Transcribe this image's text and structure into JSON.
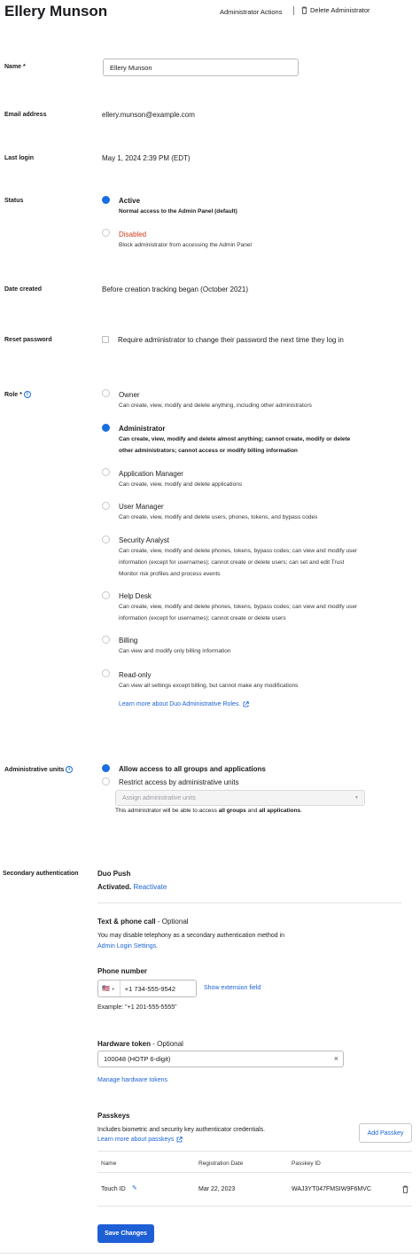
{
  "header": {
    "title": "Ellery Munson",
    "admin_actions": "Administrator Actions",
    "delete_admin": "Delete Administrator"
  },
  "name": {
    "label": "Name *",
    "value": "Ellery Munson"
  },
  "email": {
    "label": "Email address",
    "value": "ellery.munson@example.com"
  },
  "last_login": {
    "label": "Last login",
    "value": "May 1, 2024 2:39 PM (EDT)"
  },
  "status": {
    "label": "Status",
    "options": [
      {
        "title": "Active",
        "desc": "Normal access to the Admin Panel (default)",
        "selected": true
      },
      {
        "title": "Disabled",
        "desc": "Block administrator from accessing the Admin Panel",
        "selected": false,
        "color": "#d13b1f"
      }
    ]
  },
  "date_created": {
    "label": "Date created",
    "value": "Before creation tracking began (October 2021)"
  },
  "reset_password": {
    "label": "Reset password",
    "checkbox_label": "Require administrator to change their password the next time they log in",
    "checked": false
  },
  "role": {
    "label": "Role *",
    "options": [
      {
        "title": "Owner",
        "lines": [
          "Can create, view, modify and delete anything, including other administrators"
        ],
        "selected": false
      },
      {
        "title": "Administrator",
        "lines": [
          "Can create, view, modify and delete almost anything; cannot create, modify or delete",
          "other administrators; cannot access or modify billing information"
        ],
        "selected": true
      },
      {
        "title": "Application Manager",
        "lines": [
          "Can create, view, modify and delete applications"
        ],
        "selected": false
      },
      {
        "title": "User Manager",
        "lines": [
          "Can create, view, modify and delete users, phones, tokens, and bypass codes"
        ],
        "selected": false
      },
      {
        "title": "Security Analyst",
        "lines": [
          "Can create, view, modify and delete phones, tokens, bypass codes; can view and modify user",
          "information (except for usernames); cannot create or delete users; can set and edit Trust",
          "Monitor risk profiles and process events"
        ],
        "selected": false
      },
      {
        "title": "Help Desk",
        "lines": [
          "Can create, view, modify and delete phones, tokens, bypass codes; can view and modify user",
          "information (except for usernames); cannot create or delete users"
        ],
        "selected": false
      },
      {
        "title": "Billing",
        "lines": [
          "Can view and modify only billing information"
        ],
        "selected": false
      },
      {
        "title": "Read-only",
        "lines": [
          "Can view all settings except billing, but cannot make any modifications"
        ],
        "selected": false
      }
    ],
    "learn_more": "Learn more about Duo Administrative Roles."
  },
  "admin_units": {
    "label": "Administrative units",
    "option_all": "Allow access to all groups and applications",
    "option_restrict": "Restrict access by administrative units",
    "select_placeholder": "Assign administrative units",
    "note_prefix": "This administrator will be able to access ",
    "note_b1": "all groups",
    "note_mid": " and ",
    "note_b2": "all applications",
    "note_suffix": "."
  },
  "secondary_auth": {
    "label": "Secondary authentication",
    "duo_push_title": "Duo Push",
    "activated": "Activated.",
    "reactivate": "Reactivate",
    "text_phone_title": "Text & phone call",
    "optional": " - Optional",
    "telephony_line1": "You may disable telephony as a secondary authentication method in",
    "telephony_link": "Admin Login Settings",
    "telephony_end": ".",
    "phone_label": "Phone number",
    "country_flag": "🇺🇸",
    "phone_value": "+1 734-555-9542",
    "show_extension": "Show extension field",
    "phone_example": "Example: \"+1 201-555-5555\"",
    "hardware_title": "Hardware token",
    "hardware_value": "100048 (HOTP 6-digit)",
    "manage_tokens": "Manage hardware tokens",
    "passkeys_title": "Passkeys",
    "passkeys_desc": "Includes biometric and security key authenticator credentials.",
    "passkeys_learn": "Learn more about passkeys",
    "add_passkey": "Add Passkey",
    "table": {
      "columns": [
        "Name",
        "Registration Date",
        "Passkey ID"
      ],
      "rows": [
        {
          "name": "Touch ID",
          "date": "Mar 22, 2023",
          "id": "WAJ3YT047FMSIW9F6MVC"
        }
      ]
    }
  },
  "save_button": "Save Changes",
  "colors": {
    "accent": "#1a6fe0",
    "link": "#1a63d6",
    "danger": "#d13b1f",
    "button": "#1f5fd6"
  }
}
